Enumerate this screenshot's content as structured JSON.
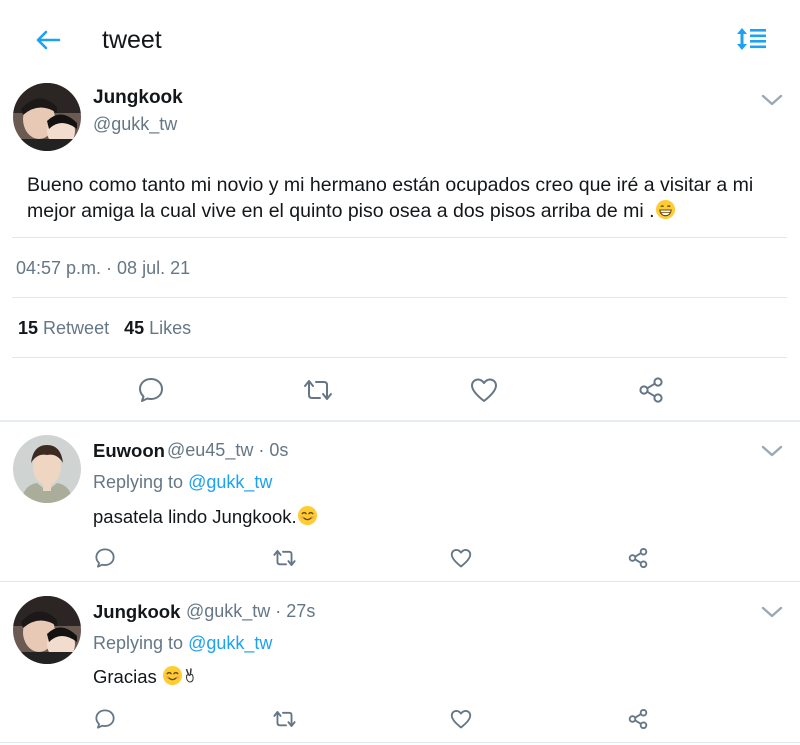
{
  "header": {
    "title": "tweet",
    "back_icon": "arrow-left-icon",
    "sort_icon": "sort-lines-icon",
    "accent_color": "#1da1f2"
  },
  "main_tweet": {
    "author_name": "Jungkook",
    "author_handle": "@gukk_tw",
    "text": "Bueno como tanto mi novio y mi hermano están ocupados creo que iré a visitar a mi mejor amiga la cual vive en el quinto piso osea a dos pisos arriba de mi .",
    "text_emoji": "grinning-face-emoji",
    "timestamp": "04:57 p.m. · 08 jul. 21",
    "retweet_count": "15",
    "retweet_label": "Retweet",
    "likes_count": "45",
    "likes_label": "Likes",
    "actions": [
      "reply-icon",
      "retweet-icon",
      "heart-icon",
      "share-icon"
    ]
  },
  "replies": [
    {
      "author_name": "Euwoon",
      "meta": "@eu45_tw · 0s",
      "replying_prefix": "Replying to",
      "replying_handle": "@gukk_tw",
      "text": "pasatela lindo Jungkook.",
      "text_emoji": "smiling-face-emoji"
    },
    {
      "author_name": "Jungkook",
      "meta": "@gukk_tw · 27s",
      "replying_prefix": "Replying to",
      "replying_handle": "@gukk_tw",
      "text": "Gracias ",
      "text_emoji": "smiling-face-victory-hand-emoji"
    }
  ],
  "colors": {
    "text_primary": "#14171a",
    "text_secondary": "#657786",
    "divider": "#e1e8ed",
    "link": "#1da1f2",
    "icon": "#657786"
  }
}
